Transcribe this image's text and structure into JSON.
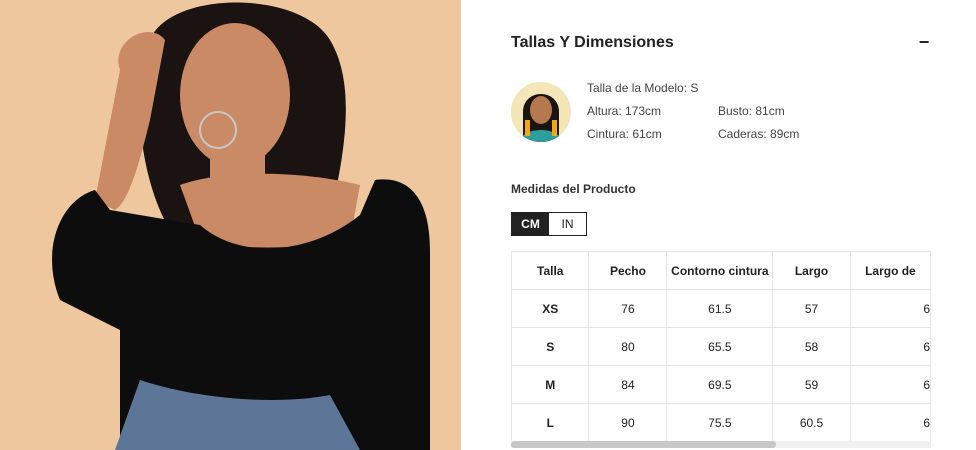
{
  "section": {
    "title": "Tallas Y Dimensiones",
    "collapse_symbol": "−"
  },
  "model": {
    "size_label": "Talla de la Modelo: S",
    "height": "Altura: 173cm",
    "bust": "Busto: 81cm",
    "waist": "Cintura: 61cm",
    "hips": "Caderas: 89cm"
  },
  "measures": {
    "title": "Medidas del Producto",
    "units": [
      "CM",
      "IN"
    ],
    "active_unit": "CM"
  },
  "size_table": {
    "headers": [
      "Talla",
      "Pecho",
      "Contorno cintura",
      "Largo",
      "Largo de"
    ],
    "rows": [
      [
        "XS",
        "76",
        "61.5",
        "57",
        "6"
      ],
      [
        "S",
        "80",
        "65.5",
        "58",
        "6"
      ],
      [
        "M",
        "84",
        "69.5",
        "59",
        "6"
      ],
      [
        "L",
        "90",
        "75.5",
        "60.5",
        "6"
      ]
    ]
  },
  "colors": {
    "accent": "#222222",
    "photo_bg": "#efc79f",
    "top": "#0d0d0d"
  }
}
